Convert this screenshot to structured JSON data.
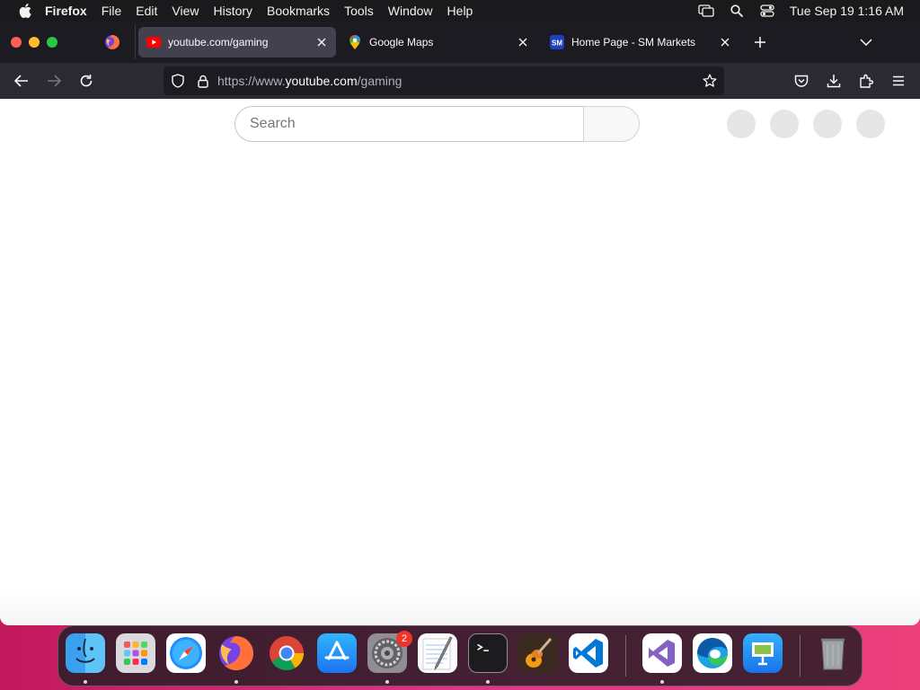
{
  "menubar": {
    "app_name": "Firefox",
    "items": [
      "File",
      "Edit",
      "View",
      "History",
      "Bookmarks",
      "Tools",
      "Window",
      "Help"
    ],
    "clock": "Tue Sep 19  1:16 AM",
    "status_icons": [
      "screen-mirroring-icon",
      "spotlight-search-icon",
      "control-center-icon"
    ]
  },
  "tabs": [
    {
      "title": "youtube.com/gaming",
      "favicon": "youtube-icon",
      "active": true
    },
    {
      "title": "Google Maps",
      "favicon": "google-maps-icon",
      "active": false
    },
    {
      "title": "Home Page - SM Markets",
      "favicon": "sm-markets-icon",
      "active": false
    }
  ],
  "navbar": {
    "url_prefix": "https://www.",
    "url_domain": "youtube.com",
    "url_path": "/gaming"
  },
  "page": {
    "search_placeholder": "Search"
  },
  "dock": {
    "apps": [
      {
        "name": "Finder",
        "running": true
      },
      {
        "name": "Launchpad",
        "running": false
      },
      {
        "name": "Safari",
        "running": false
      },
      {
        "name": "Firefox",
        "running": true
      },
      {
        "name": "Google Chrome",
        "running": false
      },
      {
        "name": "App Store",
        "running": false
      },
      {
        "name": "System Settings",
        "running": true,
        "badge": "2"
      },
      {
        "name": "TextEdit",
        "running": false
      },
      {
        "name": "Terminal",
        "running": true
      },
      {
        "name": "GarageBand",
        "running": false
      },
      {
        "name": "Visual Studio Code",
        "running": false
      },
      {
        "name": "Visual Studio",
        "running": true
      },
      {
        "name": "Microsoft Edge",
        "running": false
      },
      {
        "name": "Keynote",
        "running": false
      },
      {
        "name": "Trash",
        "running": false
      }
    ]
  },
  "colors": {
    "tabbar": "#1c1b22",
    "active_tab": "#42414d",
    "navbar": "#2b2a33",
    "youtube_red": "#ff0000",
    "wallpaper": "#e0338a"
  }
}
